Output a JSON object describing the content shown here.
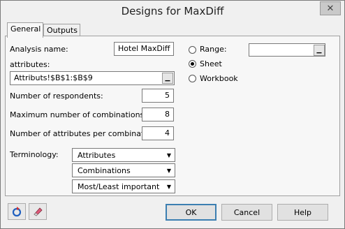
{
  "window": {
    "title": "Designs for MaxDiff",
    "close_icon": "close-icon"
  },
  "tabs": [
    {
      "label": "General"
    },
    {
      "label": "Outputs"
    }
  ],
  "general": {
    "analysis_name_label": "Analysis name:",
    "analysis_name_value": "Hotel MaxDiff",
    "attributes_label": "attributes:",
    "attributes_value": "Attributs!$B$1:$B$9",
    "respondents_label": "Number of respondents:",
    "respondents_value": "5",
    "max_combinations_label": "Maximum number of combinations:",
    "max_combinations_value": "8",
    "attrs_per_combination_label": "Number of attributes per combination:",
    "attrs_per_combination_value": "4",
    "terminology_label": "Terminology:",
    "terminology_selects": [
      "Attributes",
      "Combinations",
      "Most/Least important"
    ],
    "output_options": [
      {
        "label": "Range:",
        "checked": false
      },
      {
        "label": "Sheet",
        "checked": true
      },
      {
        "label": "Workbook",
        "checked": false
      }
    ],
    "range_value": ""
  },
  "footer": {
    "ok_label": "OK",
    "cancel_label": "Cancel",
    "help_label": "Help",
    "reset_icon": "reset-icon",
    "eraser_icon": "eraser-icon"
  }
}
